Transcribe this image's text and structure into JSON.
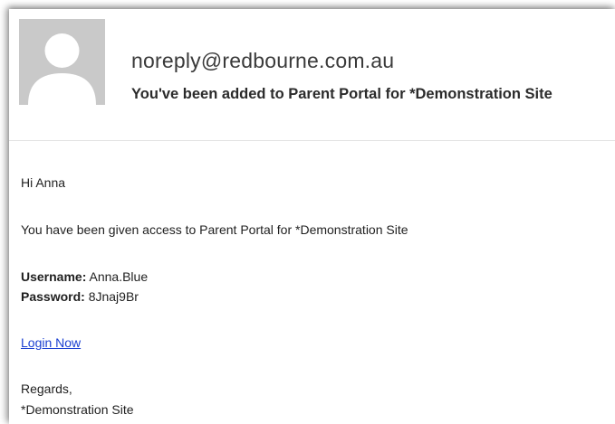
{
  "email": {
    "sender": "noreply@redbourne.com.au",
    "subject": "You've been added to Parent Portal for *Demonstration Site"
  },
  "body": {
    "greeting": "Hi Anna",
    "intro": "You have been given access to Parent Portal for *Demonstration Site",
    "username_label": "Username:",
    "username_value": " Anna.Blue",
    "password_label": "Password:",
    "password_value": " 8Jnaj9Br",
    "login_link": "Login Now",
    "regards": "Regards,",
    "signature": "*Demonstration Site"
  },
  "colors": {
    "link": "#1a3fd1",
    "avatar_bg": "#c9c9c9",
    "avatar_figure": "#ffffff"
  },
  "icons": {
    "avatar": "person-silhouette-icon"
  }
}
